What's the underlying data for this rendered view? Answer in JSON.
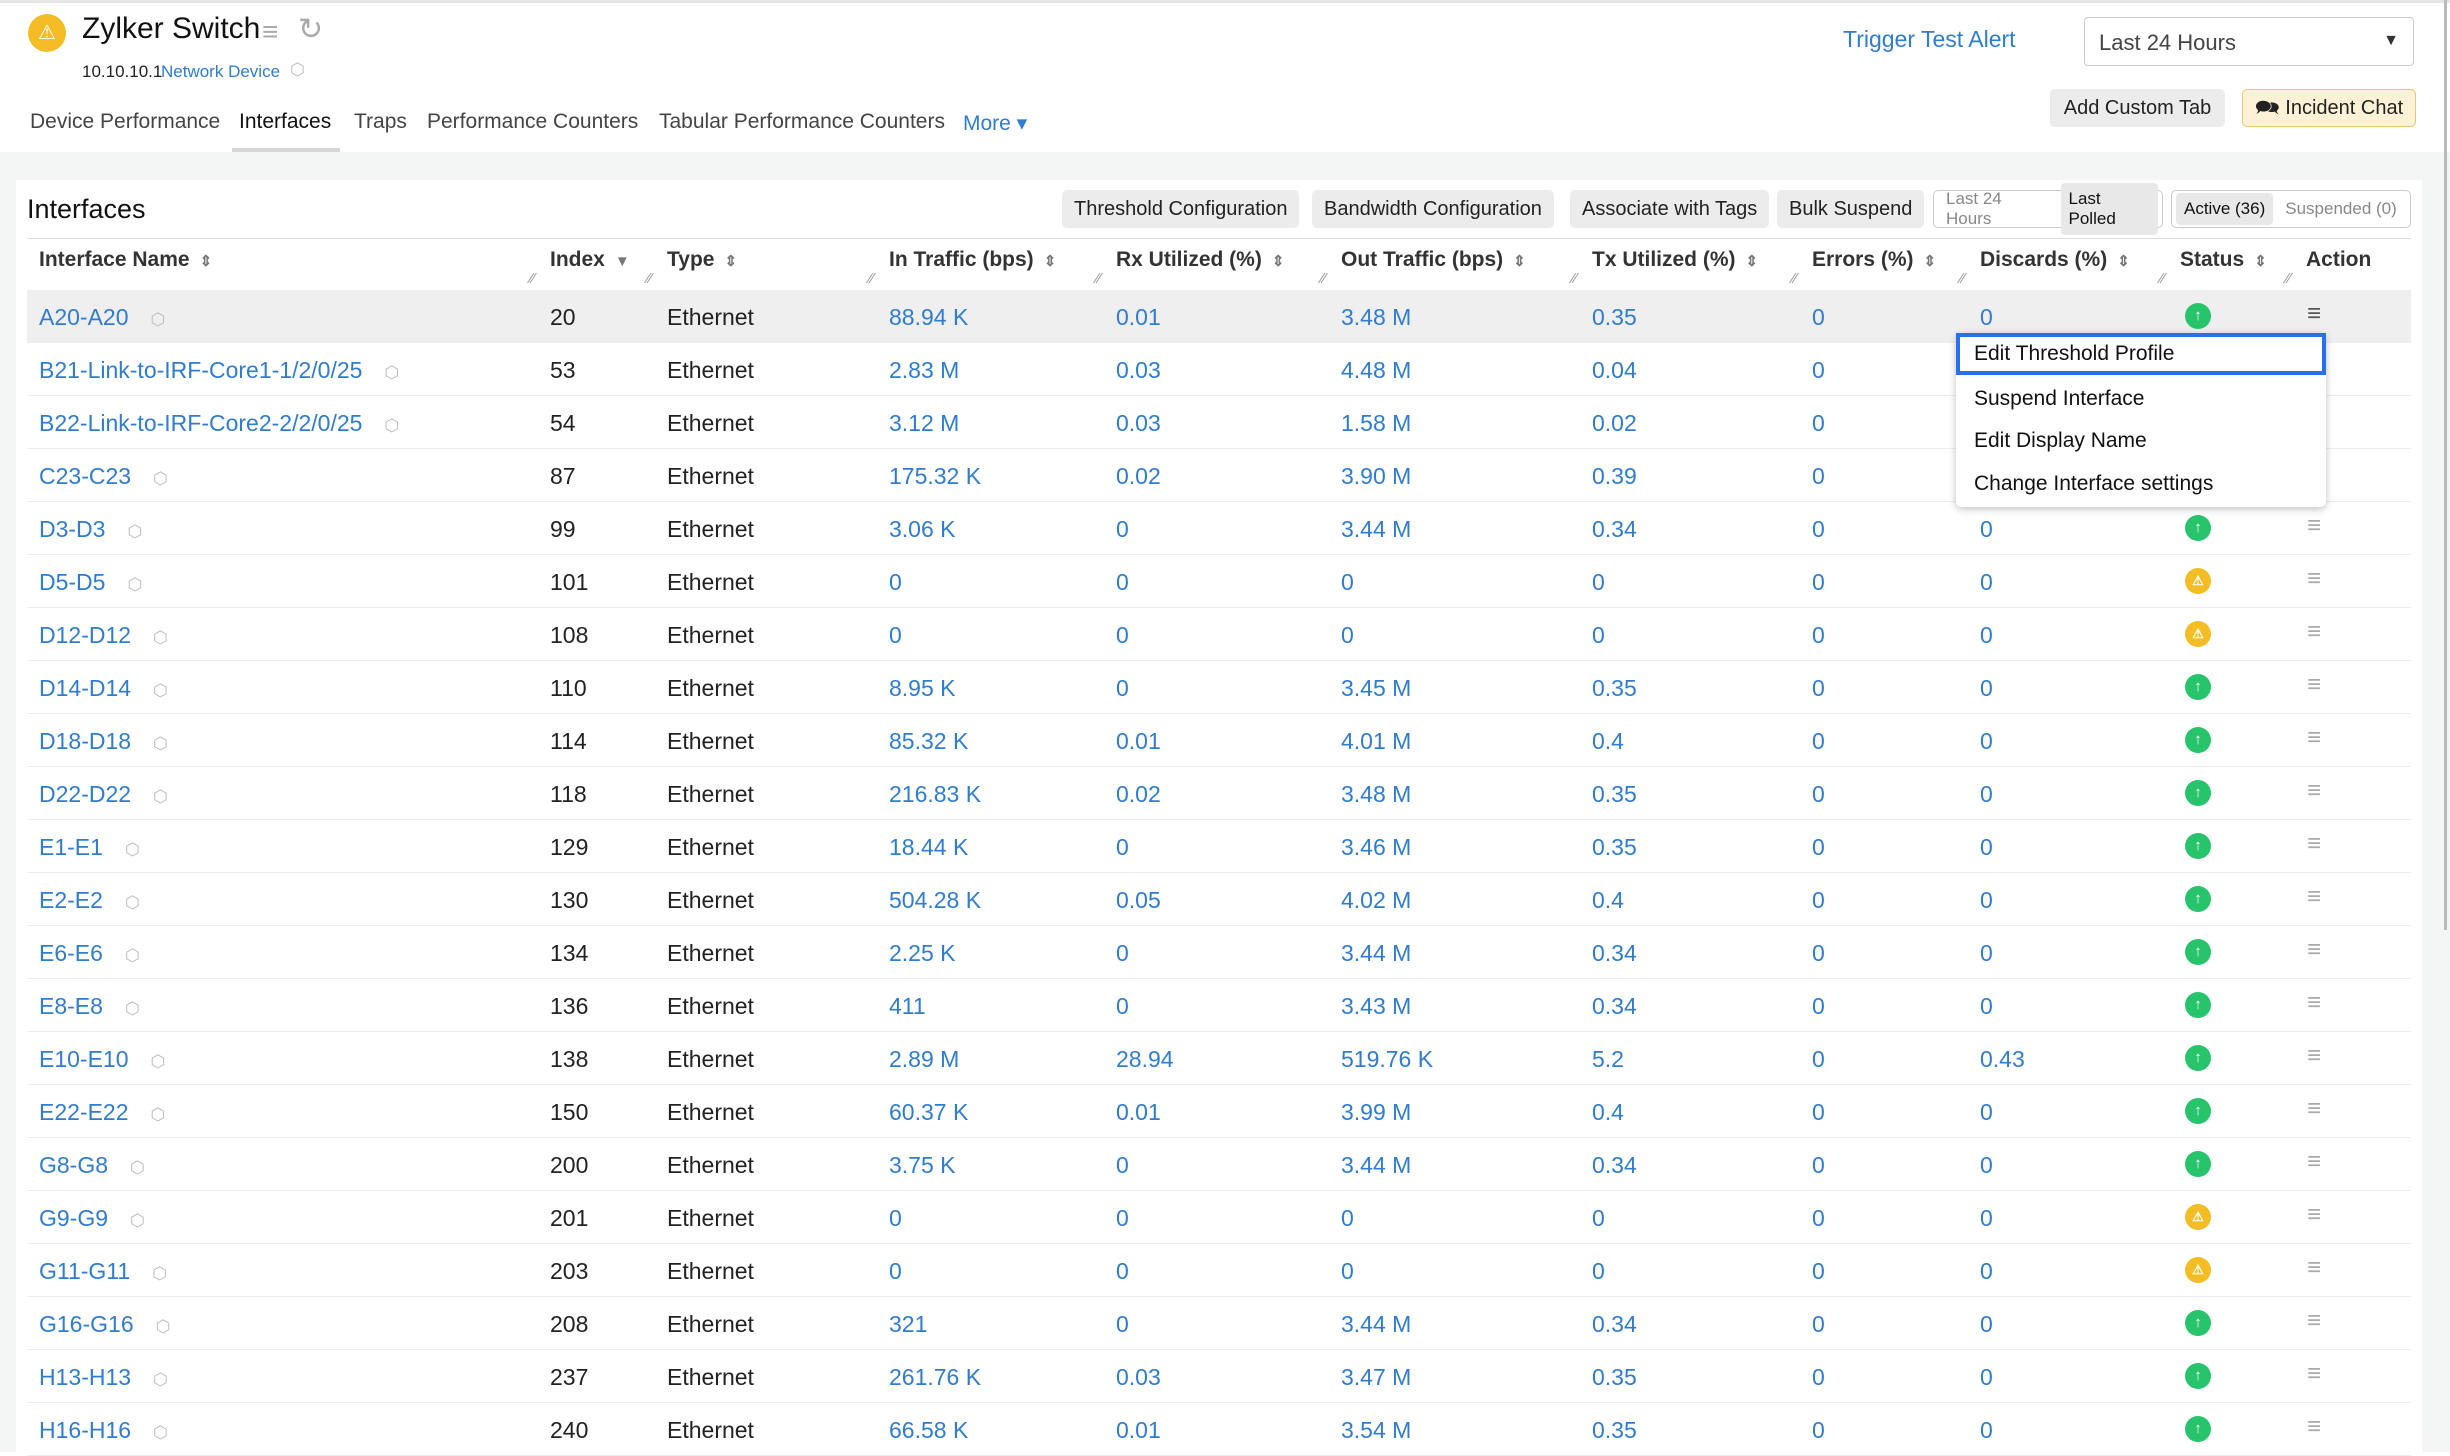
{
  "header": {
    "title": "Zylker Switch",
    "ip": "10.10.10.1",
    "device_type": "Network Device",
    "trigger_label": "Trigger Test Alert",
    "period": "Last 24 Hours",
    "add_custom_tab": "Add Custom Tab",
    "incident_chat": "Incident Chat",
    "status_color": "#f5bd25"
  },
  "tabs": [
    {
      "label": "Device Performance"
    },
    {
      "label": "Interfaces",
      "active": true
    },
    {
      "label": "Traps"
    },
    {
      "label": "Performance Counters"
    },
    {
      "label": "Tabular Performance Counters"
    },
    {
      "label": "More ▾"
    }
  ],
  "section": {
    "title": "Interfaces",
    "buttons": [
      "Threshold Configuration",
      "Bandwidth Configuration",
      "Associate with Tags",
      "Bulk Suspend"
    ],
    "range_toggle": [
      "Last 24 Hours",
      "Last Polled"
    ],
    "range_selected": "Last Polled",
    "state_toggle": [
      "Active (36)",
      "Suspended (0)"
    ],
    "state_selected": "Active (36)"
  },
  "columns": [
    "Interface Name",
    "Index",
    "Type",
    "In Traffic (bps)",
    "Rx Utilized (%)",
    "Out Traffic (bps)",
    "Tx Utilized (%)",
    "Errors (%)",
    "Discards (%)",
    "Status",
    "Action"
  ],
  "rows": [
    [
      "A20-A20",
      "20",
      "Ethernet",
      "88.94 K",
      "0.01",
      "3.48 M",
      "0.35",
      "0",
      "0",
      "up"
    ],
    [
      "B21-Link-to-IRF-Core1-1/2/0/25",
      "53",
      "Ethernet",
      "2.83 M",
      "0.03",
      "4.48 M",
      "0.04",
      "0",
      "",
      ""
    ],
    [
      "B22-Link-to-IRF-Core2-2/2/0/25",
      "54",
      "Ethernet",
      "3.12 M",
      "0.03",
      "1.58 M",
      "0.02",
      "0",
      "",
      ""
    ],
    [
      "C23-C23",
      "87",
      "Ethernet",
      "175.32 K",
      "0.02",
      "3.90 M",
      "0.39",
      "0",
      "",
      ""
    ],
    [
      "D3-D3",
      "99",
      "Ethernet",
      "3.06 K",
      "0",
      "3.44 M",
      "0.34",
      "0",
      "0",
      "up"
    ],
    [
      "D5-D5",
      "101",
      "Ethernet",
      "0",
      "0",
      "0",
      "0",
      "0",
      "0",
      "warning"
    ],
    [
      "D12-D12",
      "108",
      "Ethernet",
      "0",
      "0",
      "0",
      "0",
      "0",
      "0",
      "warning"
    ],
    [
      "D14-D14",
      "110",
      "Ethernet",
      "8.95 K",
      "0",
      "3.45 M",
      "0.35",
      "0",
      "0",
      "up"
    ],
    [
      "D18-D18",
      "114",
      "Ethernet",
      "85.32 K",
      "0.01",
      "4.01 M",
      "0.4",
      "0",
      "0",
      "up"
    ],
    [
      "D22-D22",
      "118",
      "Ethernet",
      "216.83 K",
      "0.02",
      "3.48 M",
      "0.35",
      "0",
      "0",
      "up"
    ],
    [
      "E1-E1",
      "129",
      "Ethernet",
      "18.44 K",
      "0",
      "3.46 M",
      "0.35",
      "0",
      "0",
      "up"
    ],
    [
      "E2-E2",
      "130",
      "Ethernet",
      "504.28 K",
      "0.05",
      "4.02 M",
      "0.4",
      "0",
      "0",
      "up"
    ],
    [
      "E6-E6",
      "134",
      "Ethernet",
      "2.25 K",
      "0",
      "3.44 M",
      "0.34",
      "0",
      "0",
      "up"
    ],
    [
      "E8-E8",
      "136",
      "Ethernet",
      "411",
      "0",
      "3.43 M",
      "0.34",
      "0",
      "0",
      "up"
    ],
    [
      "E10-E10",
      "138",
      "Ethernet",
      "2.89 M",
      "28.94",
      "519.76 K",
      "5.2",
      "0",
      "0.43",
      "up"
    ],
    [
      "E22-E22",
      "150",
      "Ethernet",
      "60.37 K",
      "0.01",
      "3.99 M",
      "0.4",
      "0",
      "0",
      "up"
    ],
    [
      "G8-G8",
      "200",
      "Ethernet",
      "3.75 K",
      "0",
      "3.44 M",
      "0.34",
      "0",
      "0",
      "up"
    ],
    [
      "G9-G9",
      "201",
      "Ethernet",
      "0",
      "0",
      "0",
      "0",
      "0",
      "0",
      "warning"
    ],
    [
      "G11-G11",
      "203",
      "Ethernet",
      "0",
      "0",
      "0",
      "0",
      "0",
      "0",
      "warning"
    ],
    [
      "G16-G16",
      "208",
      "Ethernet",
      "321",
      "0",
      "3.44 M",
      "0.34",
      "0",
      "0",
      "up"
    ],
    [
      "H13-H13",
      "237",
      "Ethernet",
      "261.76 K",
      "0.03",
      "3.47 M",
      "0.35",
      "0",
      "0",
      "up"
    ],
    [
      "H16-H16",
      "240",
      "Ethernet",
      "66.58 K",
      "0.01",
      "3.54 M",
      "0.35",
      "0",
      "0",
      "up"
    ]
  ],
  "action_menu": [
    "Edit Threshold Profile",
    "Suspend Interface",
    "Edit Display Name",
    "Change Interface settings"
  ],
  "colors": {
    "link": "#2f7cd0",
    "up": "#27c46b",
    "warning": "#f5bd25",
    "menu_highlight": "#2a6ff0"
  }
}
